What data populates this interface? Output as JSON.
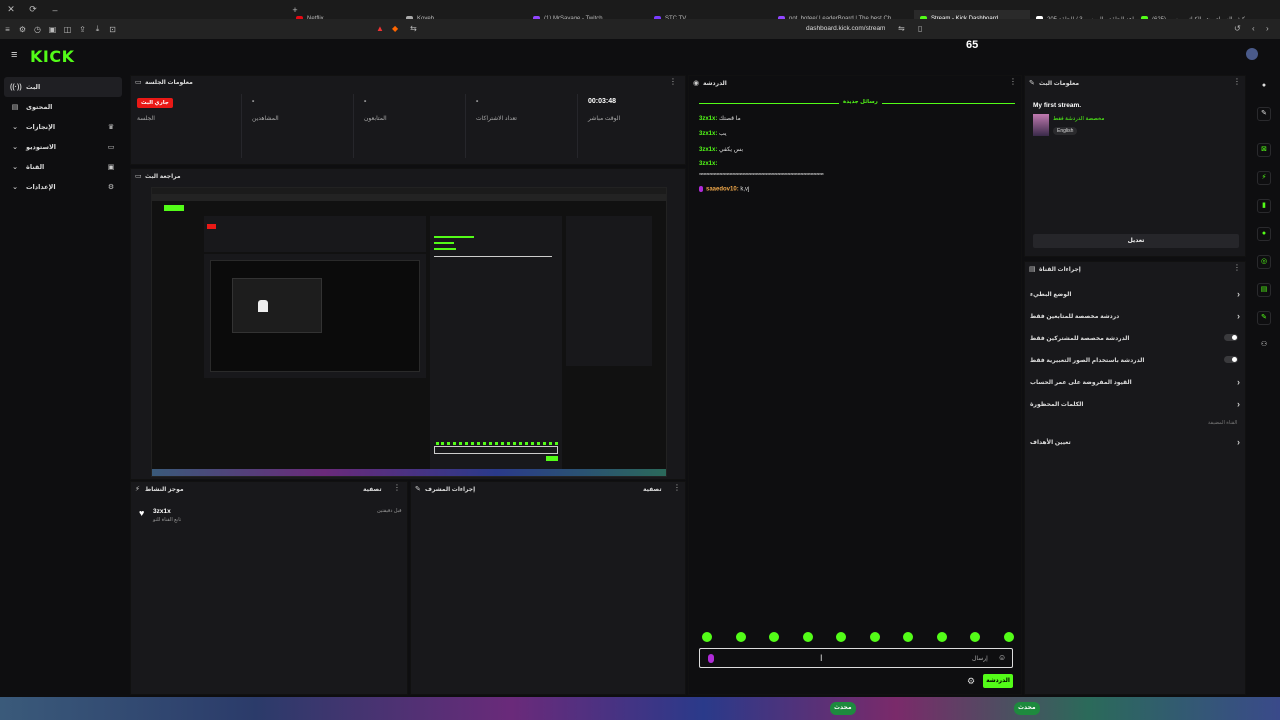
{
  "browser": {
    "tabs": [
      {
        "label": "Netflix",
        "icon": "netflix-icon",
        "color": "#e50914"
      },
      {
        "label": "Koyeb",
        "icon": "koyeb-icon",
        "color": "#aaaaaa"
      },
      {
        "label": "(1) MrSavage - Twitch",
        "icon": "twitch-icon",
        "color": "#9146ff"
      },
      {
        "label": "STC TV",
        "icon": "stctv-icon",
        "color": "#7a3cff"
      },
      {
        "label": "not_botee/ LeaderBoard | The best Ch",
        "icon": "github-icon",
        "color": "#9146ff"
      },
      {
        "label": "Stream - Kick Dashboard",
        "icon": "kick-icon",
        "color": "#53fc18",
        "active": true
      },
      {
        "label": "شاهد الحلقة - الموسم 3 / الحلقة 205",
        "icon": "video-icon",
        "color": "#ffffff"
      },
      {
        "label": "(625) كيف السواي بث بالكيك بي سي",
        "icon": "youtube-icon",
        "color": "#53fc18"
      }
    ],
    "url": "dashboard.kick.com/stream"
  },
  "header": {
    "logo": "KICK",
    "viewers": "65"
  },
  "nav": {
    "items": [
      {
        "label": "البث",
        "icon": "broadcast-icon",
        "active": true
      },
      {
        "label": "المحتوى",
        "icon": "content-icon"
      },
      {
        "label": "الإنجازات",
        "icon": "trophy-icon",
        "expand": true
      },
      {
        "label": "الاستوديو",
        "icon": "studio-icon",
        "expand": true
      },
      {
        "label": "القناة",
        "icon": "channel-icon",
        "expand": true
      },
      {
        "label": "الإعدادات",
        "icon": "settings-icon",
        "expand": true
      }
    ]
  },
  "session": {
    "title": "معلومات الجلسة",
    "live_badge": "جاري البث",
    "session_label": "الجلسة",
    "stats": [
      {
        "value": "-",
        "label": "المشاهدين"
      },
      {
        "value": "-",
        "label": "المتابعون"
      },
      {
        "value": "-",
        "label": "تعداد الاشتراكات"
      },
      {
        "value": "00:03:48",
        "label": "الوقت مباشر"
      }
    ]
  },
  "preview": {
    "title": "مراجعة البث"
  },
  "activity": {
    "title": "موجز النشاط",
    "filter": "تصفية",
    "item": {
      "user": "3zx1x",
      "sub": "تابع القناة للتو",
      "right": "قبل دقيقتين"
    }
  },
  "mod": {
    "title": "إجراءات المشرف",
    "filter": "تصفية"
  },
  "chat": {
    "title": "الدردشة",
    "banner": "رسائل جديدة",
    "lines": [
      {
        "user": "3zx1x:",
        "text": "ما قصتك"
      },
      {
        "user": "3zx1x:",
        "text": "يب"
      },
      {
        "user": "3zx1x:",
        "text": "بس يكفي"
      },
      {
        "user": "3zx1x:",
        "text": ""
      },
      {
        "user": "",
        "text": "**************************************************************************************"
      },
      {
        "user": "saaedov10:",
        "text": "k,vj"
      }
    ],
    "input_placeholder": "إرسال",
    "send_label": "الدردشة"
  },
  "stream_info": {
    "title": "معلومات البث",
    "stream_title": "My first stream.",
    "category": "مخصصة الدردشة فقط",
    "language": "English",
    "edit_label": "تعديل"
  },
  "channel_actions": {
    "title": "إجراءات القناة",
    "items": [
      {
        "label": "الوضع البطيء",
        "kind": "chevron"
      },
      {
        "label": "دردشة مخصصة للمتابعين فقط",
        "kind": "chevron"
      },
      {
        "label": "الدردشة مخصصة للمشتركين فقط",
        "kind": "toggle"
      },
      {
        "label": "الدردشة باستخدام الصور التعبيرية فقط",
        "kind": "toggle"
      },
      {
        "label": "القيود المفروضة على عمر الحساب",
        "kind": "chevron"
      },
      {
        "label": "الكلمات المحظورة",
        "kind": "chevron"
      }
    ],
    "section_label": "القناة المضيفة",
    "goals_label": "تعيين الأهداف"
  },
  "taskbar": {
    "chips": [
      "محدث",
      "محدث"
    ]
  },
  "colors": {
    "accent": "#53fc18",
    "live": "#e91916",
    "bg": "#0e0e10",
    "panel": "#18181b"
  }
}
